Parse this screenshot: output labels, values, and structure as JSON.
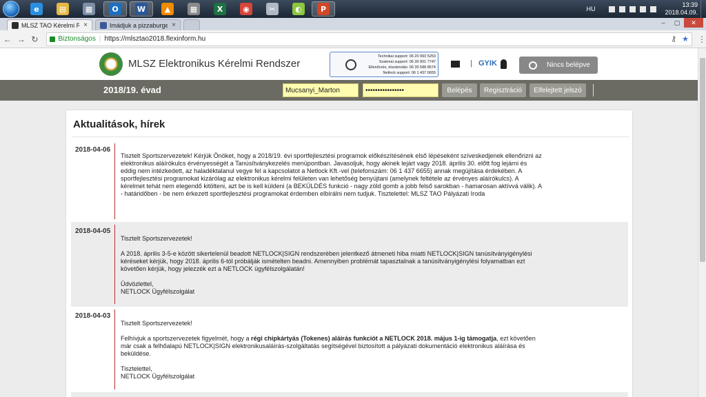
{
  "taskbar": {
    "apps": [
      {
        "name": "internet-explorer-icon",
        "glyph": "e",
        "color": "#2a8ee0"
      },
      {
        "name": "file-explorer-icon",
        "glyph": "▤",
        "color": "#e3b844"
      },
      {
        "name": "calculator-icon",
        "glyph": "▦",
        "color": "#7d8fa6"
      },
      {
        "name": "outlook-icon",
        "glyph": "O",
        "color": "#1d6fbf"
      },
      {
        "name": "word-icon",
        "glyph": "W",
        "color": "#2b5797"
      },
      {
        "name": "vlc-icon",
        "glyph": "▲",
        "color": "#f08a00"
      },
      {
        "name": "calendar-icon",
        "glyph": "▦",
        "color": "#8a8a8a"
      },
      {
        "name": "excel-icon",
        "glyph": "X",
        "color": "#1e7145"
      },
      {
        "name": "chrome-icon",
        "glyph": "◉",
        "color": "#d6453b"
      },
      {
        "name": "snipping-tool-icon",
        "glyph": "✂",
        "color": "#b0b8c6"
      },
      {
        "name": "lime-app-icon",
        "glyph": "◐",
        "color": "#8cc63f"
      },
      {
        "name": "powerpoint-icon",
        "glyph": "P",
        "color": "#d24726"
      }
    ],
    "language": "HU",
    "time": "13:39",
    "date": "2018.04.09."
  },
  "browser": {
    "tabs": [
      {
        "title": "MLSZ TAO Kérelmi Rendsz",
        "close": "×"
      },
      {
        "title": "Imádjuk a pizzaburgert!",
        "close": "×"
      }
    ],
    "secure_label": "Biztonságos",
    "url": "https://mlsztao2018.flexinform.hu"
  },
  "header": {
    "site_title": "MLSZ Elektronikus Kérelmi Rendszer",
    "support_lines": [
      "Technikai support: 06 20 993 5253",
      "Szakmai support: 06 30 901 7747",
      "Ellenőrzés, elszámolás: 06 30 588 8574",
      "Netlock support: 06 1 437 6655"
    ],
    "gyik": "GYIK",
    "login_status": "Nincs belépve"
  },
  "login": {
    "season": "2018/19. évad",
    "username": "Mucsanyi_Marton",
    "password": "••••••••••••••••",
    "login_btn": "Belépés",
    "register_btn": "Regisztráció",
    "forgot_btn": "Elfelejtett jelszó"
  },
  "news": {
    "heading": "Aktualitások, hírek",
    "entries": [
      {
        "date": "2018-04-06",
        "p1": "Tisztelt Sportszervezetek! Kérjük Önöket, hogy a 2018/19. évi sportfejlesztési programok előkészítésének első lépéseként szíveskedjenek ellenőrizni az elektronikus aláírókulcs érvényességét a Tanúsítványkezelés menüpontban. Javasoljuk, hogy akinek lejárt vagy 2018. április 30. előtt fog lejárni és eddig nem intézkedett, az haladéktalanul vegye fel a kapcsolatot a Netlock Kft.-vel (telefonszám: 06 1 437 6655) annak megújítása érdekében. A sportfejlesztési programokat kizárólag az elektronikus kérelmi felületen van lehetőség benyújtani (amelynek feltétele az érvényes aláírókulcs). A kérelmet tehát nem elegendő kitölteni, azt be is kell küldeni (a BEKÜLDÉS funkció - nagy zöld gomb a jobb felső sarokban - hamarosan aktívvá válik). A - határidőben - be nem érkezett sportfejlesztési programokat érdemben elbírálni nem tudjuk. Tisztelettel: MLSZ TAO Pályázati Iroda"
      },
      {
        "date": "2018-04-05",
        "greeting": "Tisztelt Sportszervezetek!",
        "p1": "A 2018. április 3-5-e között sikertelenül beadott NETLOCK|SIGN rendszerében jelentkező átmeneti hiba miatti NETLOCK|SIGN tanúsítványigénylési kéréseket kérjük, hogy 2018. április 6-tól próbálják ismételten beadni. Amennyiben problémát tapasztalnak a tanúsítványigénylési folyamatban ezt követően kérjük, hogy jelezzék ezt a NETLOCK ügyfélszolgálatán!",
        "closing": "Üdvözlettel,",
        "signature": "NETLOCK Ügyfélszolgálat"
      },
      {
        "date": "2018-04-03",
        "greeting": "Tisztelt Sportszervezetek!",
        "p1_pre": "Felhívjuk a sportszervezetek figyelmét, hogy a ",
        "p1_bold1": "régi chipkártyás (Tokenes) aláírás funkciót a NETLOCK 2018. május 1-ig támogatja",
        "p1_post": ", ezt követően már csak a felhőalapú NETLOCK|SIGN elektronikusaláírás-szolgáltatás segítségével biztosított a pályázati dokumentáció elektronikus aláírása és beküldése.",
        "closing": "Tisztelettel,",
        "signature": "NETLOCK Ügyfélszolgálat"
      }
    ]
  }
}
